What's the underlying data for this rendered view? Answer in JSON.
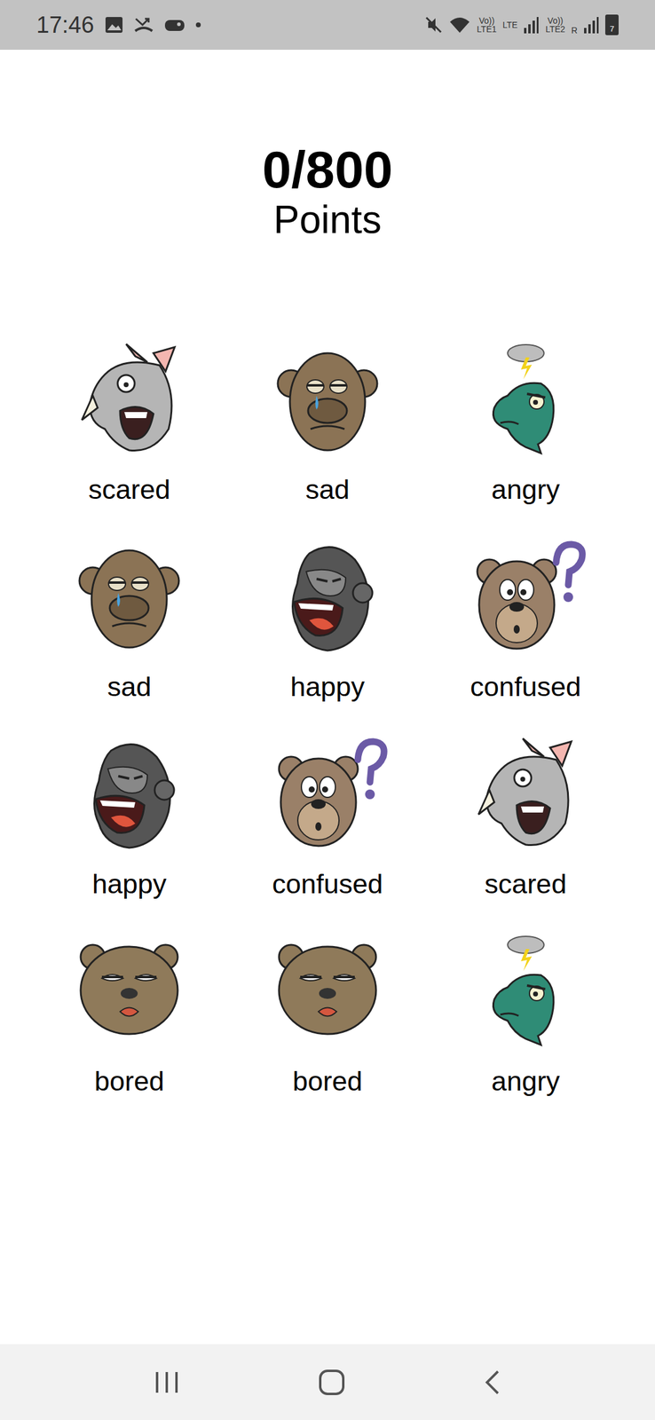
{
  "status_bar": {
    "time": "17:46",
    "sim1_voice": "Vo))",
    "sim1_label": "LTE1",
    "data": "LTE",
    "sim2_voice": "Vo))",
    "sim2_label": "LTE2",
    "roaming": "R",
    "battery": "7"
  },
  "score": {
    "value": "0/800",
    "label": "Points"
  },
  "cards": [
    {
      "label": "scared",
      "kind": "rhino"
    },
    {
      "label": "sad",
      "kind": "monkey"
    },
    {
      "label": "angry",
      "kind": "dino"
    },
    {
      "label": "sad",
      "kind": "monkey"
    },
    {
      "label": "happy",
      "kind": "gorilla"
    },
    {
      "label": "confused",
      "kind": "bear"
    },
    {
      "label": "happy",
      "kind": "gorilla"
    },
    {
      "label": "confused",
      "kind": "bear"
    },
    {
      "label": "scared",
      "kind": "rhino"
    },
    {
      "label": "bored",
      "kind": "bored-bear"
    },
    {
      "label": "bored",
      "kind": "bored-bear"
    },
    {
      "label": "angry",
      "kind": "dino"
    }
  ]
}
